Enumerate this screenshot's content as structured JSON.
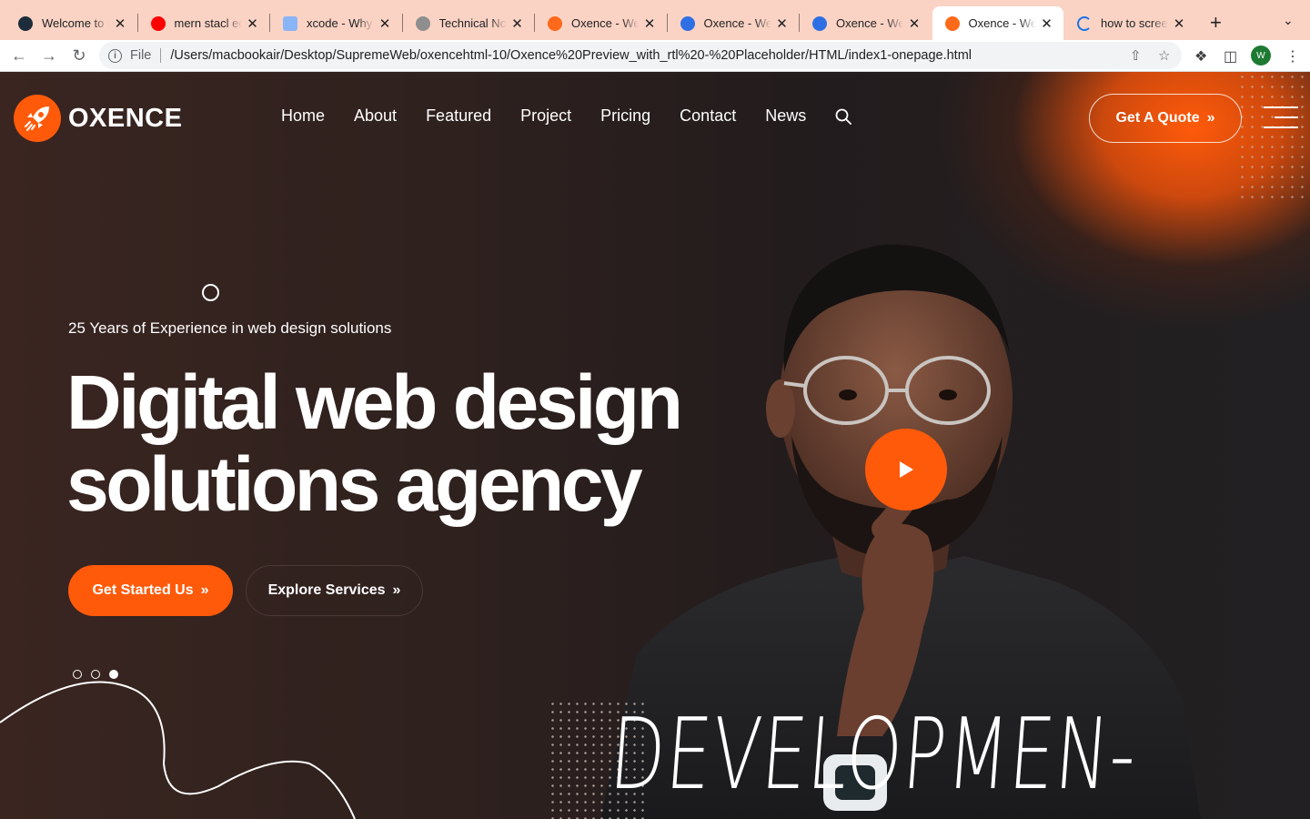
{
  "browser": {
    "tabs": [
      {
        "title": "Welcome to Su",
        "favicon": "react-icon",
        "color": "#1c2c3a",
        "active": false
      },
      {
        "title": "mern stacl eco",
        "favicon": "youtube-icon",
        "color": "#ff0000",
        "active": false
      },
      {
        "title": "xcode - Why a",
        "favicon": "command-icon",
        "color": "#8ab4f8",
        "active": false
      },
      {
        "title": "Technical Note",
        "favicon": "apple-icon",
        "color": "#8e8e8e",
        "active": false
      },
      {
        "title": "Oxence - Web",
        "favicon": "oxence-icon",
        "color": "#ff6a1a",
        "active": false
      },
      {
        "title": "Oxence - Web",
        "favicon": "firefox-icon",
        "color": "#2f6fe4",
        "active": false
      },
      {
        "title": "Oxence - Web",
        "favicon": "firefox-icon",
        "color": "#2f6fe4",
        "active": false
      },
      {
        "title": "Oxence - Web",
        "favicon": "oxence-icon",
        "color": "#ff6a1a",
        "active": true
      },
      {
        "title": "how to screen",
        "favicon": "loading-icon",
        "color": "#1a73e8",
        "active": false
      }
    ],
    "address": {
      "scheme": "File",
      "url": "/Users/macbookair/Desktop/SupremeWeb/oxencehtml-10/Oxence%20Preview_with_rtl%20-%20Placeholder/HTML/index1-onepage.html"
    },
    "profile_initial": "W"
  },
  "site": {
    "logo_text": "OXENCE",
    "nav": [
      "Home",
      "About",
      "Featured",
      "Project",
      "Pricing",
      "Contact",
      "News"
    ],
    "quote_button": "Get A Quote",
    "hero": {
      "eyebrow": "25 Years of Experience in web design solutions",
      "headline_line1": "Digital web design",
      "headline_line2": "solutions agency",
      "primary_button": "Get Started Us",
      "secondary_button": "Explore Services",
      "slides_total": 3,
      "active_slide": 3,
      "background_word": "DEVELOPMEN-"
    },
    "colors": {
      "accent": "#ff5a0a",
      "background": "#231b1c"
    }
  }
}
